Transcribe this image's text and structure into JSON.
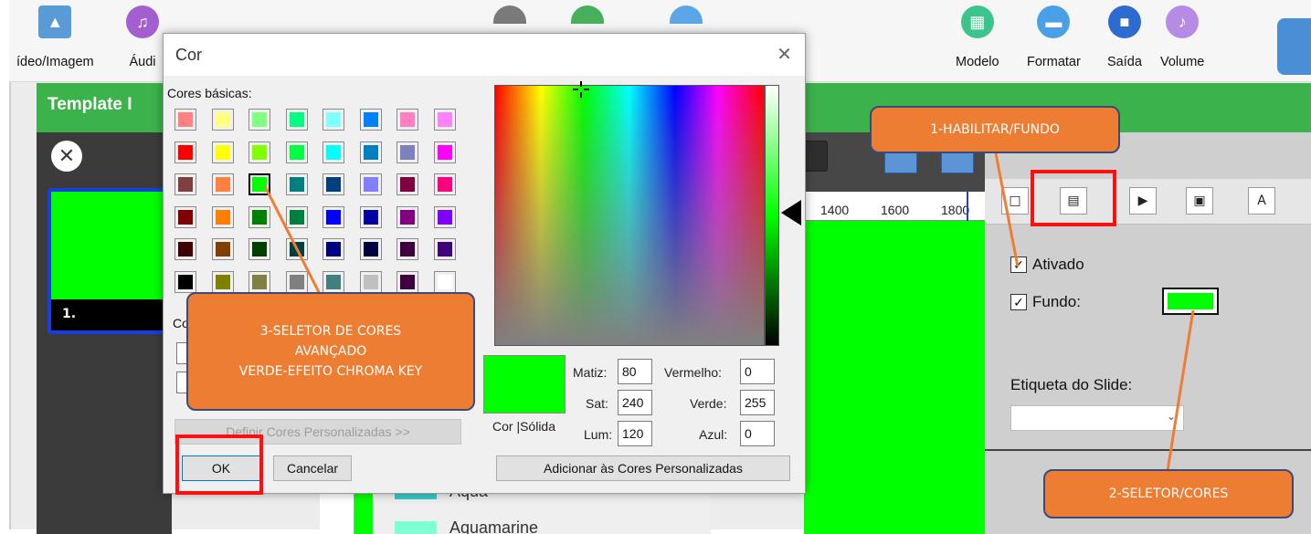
{
  "toolbar": {
    "items": [
      {
        "label": "ídeo/Imagem",
        "icon": "image-icon"
      },
      {
        "label": "Áudi",
        "icon": "music-icon"
      },
      {
        "label": "Modelo",
        "icon": "template-icon"
      },
      {
        "label": "Formatar",
        "icon": "format-icon"
      },
      {
        "label": "Saída",
        "icon": "output-icon"
      },
      {
        "label": "Volume",
        "icon": "volume-icon"
      }
    ]
  },
  "header": {
    "template_title": "Template I"
  },
  "slides": [
    {
      "number": "1."
    }
  ],
  "ruler": {
    "ticks": [
      "1400",
      "1600",
      "1800"
    ]
  },
  "color_list": [
    {
      "name": "Aqua",
      "color": "#33cccc"
    },
    {
      "name": "Aquamarine",
      "color": "#7fffd4"
    }
  ],
  "properties": {
    "ativado_label": "Ativado",
    "ativado_checked": true,
    "fundo_label": "Fundo:",
    "fundo_checked": true,
    "fundo_color": "#00ff00",
    "etiqueta_label": "Etiqueta do Slide:",
    "etiqueta_value": ""
  },
  "dialog": {
    "title": "Cor",
    "basic_colors_label": "Cores básicas:",
    "basic_colors": [
      [
        "#ff8080",
        "#ffff80",
        "#80ff80",
        "#00ff80",
        "#80ffff",
        "#0080ff",
        "#ff80c0",
        "#ff80ff"
      ],
      [
        "#ff0000",
        "#ffff00",
        "#80ff00",
        "#00ff40",
        "#00ffff",
        "#0080c0",
        "#8080c0",
        "#ff00ff"
      ],
      [
        "#804040",
        "#ff8040",
        "#00ff00",
        "#008080",
        "#004080",
        "#8080ff",
        "#800040",
        "#ff0080"
      ],
      [
        "#800000",
        "#ff8000",
        "#008000",
        "#008040",
        "#0000ff",
        "#0000a0",
        "#800080",
        "#8000ff"
      ],
      [
        "#400000",
        "#804000",
        "#004000",
        "#004040",
        "#000080",
        "#000040",
        "#400040",
        "#400080"
      ],
      [
        "#000000",
        "#808000",
        "#808040",
        "#808080",
        "#408080",
        "#c0c0c0",
        "#400040",
        "#ffffff"
      ]
    ],
    "selected_basic": {
      "row": 2,
      "col": 2
    },
    "custom_colors_label": "Co",
    "define_custom_label": "Definir Cores Personalizadas >>",
    "ok_label": "OK",
    "cancel_label": "Cancelar",
    "preview_label": "Cor |Sólida",
    "preview_color": "#00ff00",
    "hue_label": "Matiz:",
    "hue_value": "80",
    "sat_label": "Sat:",
    "sat_value": "240",
    "lum_label": "Lum:",
    "lum_value": "120",
    "red_label": "Vermelho:",
    "red_value": "0",
    "green_label": "Verde:",
    "green_value": "255",
    "blue_label": "Azul:",
    "blue_value": "0",
    "add_custom_label": "Adicionar às Cores Personalizadas"
  },
  "annotations": {
    "callout1": "1-HABILITAR/FUNDO",
    "callout2": "2-SELETOR/CORES",
    "callout3_line1": "3-SELETOR DE CORES",
    "callout3_line2": "AVANÇADO",
    "callout3_line3": "VERDE-EFEITO CHROMA KEY",
    "callout_color": "#ee7d34",
    "highlight_color": "#ff1010"
  }
}
